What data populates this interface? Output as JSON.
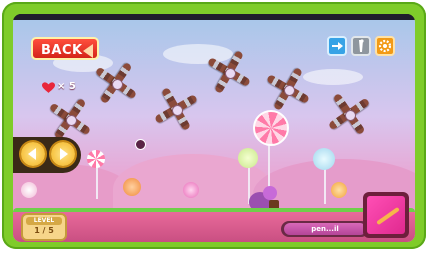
{
  "hud": {
    "back_label": "BACK",
    "lives_text": "× 5",
    "level": {
      "label": "LEVEL",
      "value": "1 / 5"
    },
    "tool_label": "pen...il"
  },
  "icons": {
    "top_right": [
      "share-icon",
      "bookmark-icon",
      "settings-gear-icon"
    ],
    "left_controls": [
      "left-arrow-icon",
      "right-arrow-icon"
    ],
    "lives": "heart-icon",
    "tool": "pencil-icon"
  },
  "colors": {
    "frame": "#7fcc2a",
    "back_button": "#e8352a",
    "share_button": "#37a3e6",
    "bookmark_button": "#9aa2aa",
    "settings_button": "#f29a16",
    "arrow_buttons": "#f7c43a",
    "tool_panel": "#e0298f"
  }
}
